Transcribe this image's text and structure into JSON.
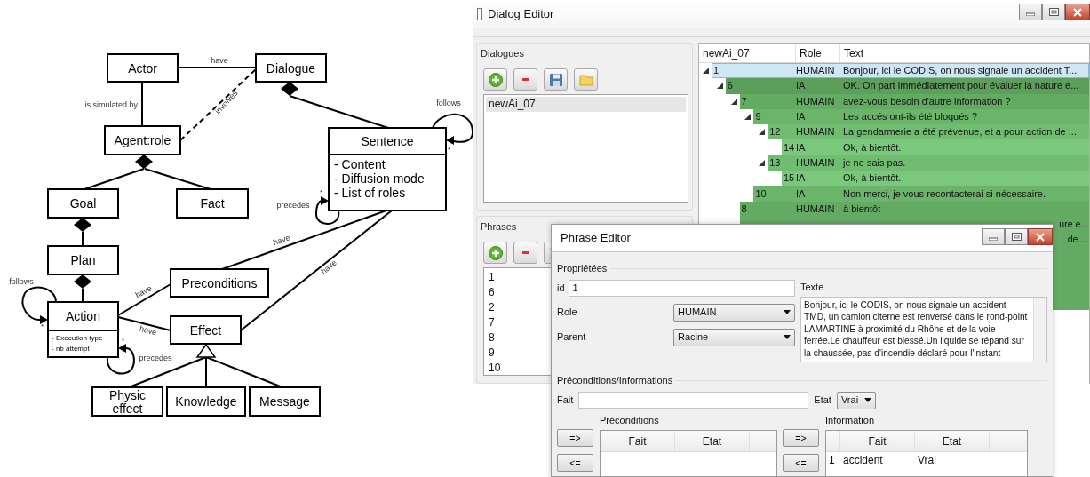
{
  "diagram": {
    "classes": [
      {
        "name": "Actor"
      },
      {
        "name": "Dialogue"
      },
      {
        "name": "Agent:role"
      },
      {
        "name": "Goal"
      },
      {
        "name": "Fact"
      },
      {
        "name": "Plan"
      },
      {
        "name": "Action",
        "attributes": [
          "-  Execution type",
          "- nb attempt"
        ]
      },
      {
        "name": "Preconditions"
      },
      {
        "name": "Effect"
      },
      {
        "name": "Physic effect"
      },
      {
        "name": "Knowledge"
      },
      {
        "name": "Message"
      },
      {
        "name": "Sentence",
        "attributes": [
          "- Content",
          "- Diffusion mode",
          "- List of roles"
        ]
      }
    ],
    "relations": [
      {
        "kind": "association",
        "label": "have"
      },
      {
        "kind": "association",
        "label": "is simulated by"
      },
      {
        "kind": "dependency",
        "label": "involves"
      },
      {
        "kind": "composition"
      },
      {
        "kind": "composition"
      },
      {
        "kind": "composition"
      },
      {
        "kind": "composition"
      },
      {
        "kind": "loop",
        "label": "follows",
        "multiplicity": "*"
      },
      {
        "kind": "loop",
        "label": "precedes",
        "multiplicity": "*"
      },
      {
        "kind": "association",
        "label": "have"
      },
      {
        "kind": "association",
        "label": "have"
      },
      {
        "kind": "association",
        "label": "have"
      },
      {
        "kind": "association",
        "label": "have"
      },
      {
        "kind": "loop",
        "label": "follows",
        "multiplicity": "*"
      },
      {
        "kind": "loop",
        "label": "precedes",
        "multiplicity": "*"
      },
      {
        "kind": "generalization"
      }
    ]
  },
  "dialog_editor": {
    "title": "Dialog Editor",
    "dialogues": {
      "label": "Dialogues",
      "items": [
        {
          "label": "newAi_07",
          "selected": true
        }
      ]
    },
    "phrases": {
      "label": "Phrases",
      "items": [
        "1",
        "6",
        "2",
        "7",
        "8",
        "9",
        "10"
      ]
    },
    "tree": {
      "columns": [
        "newAi_07",
        "Role",
        "Text"
      ],
      "rows": [
        {
          "id": "1",
          "role": "HUMAIN",
          "text": "Bonjour, ici le CODIS, on nous signale un accident T...",
          "selected": true,
          "expanded": true,
          "children": [
            {
              "id": "6",
              "role": "IA",
              "text": "OK. On part immédiatement pour évaluer la nature e...",
              "selected": false,
              "expanded": true,
              "children": [
                {
                  "id": "7",
                  "role": "HUMAIN",
                  "text": "avez-vous besoin d'autre information ?",
                  "selected": false,
                  "expanded": true,
                  "children": [
                    {
                      "id": "9",
                      "role": "IA",
                      "text": "Les accés ont-ils été bloqués ?",
                      "selected": false,
                      "expanded": true,
                      "children": [
                        {
                          "id": "12",
                          "role": "HUMAIN",
                          "text": "La gendarmerie a été prévenue, et a pour action de ...",
                          "selected": false,
                          "expanded": true,
                          "children": [
                            {
                              "id": "14",
                              "role": "IA",
                              "text": "Ok, à bientôt.",
                              "selected": false
                            }
                          ]
                        },
                        {
                          "id": "13",
                          "role": "HUMAIN",
                          "text": "je ne sais pas.",
                          "selected": false,
                          "expanded": true,
                          "children": [
                            {
                              "id": "15",
                              "role": "IA",
                              "text": "Ok, à bientôt.",
                              "selected": false
                            }
                          ]
                        }
                      ]
                    },
                    {
                      "id": "10",
                      "role": "IA",
                      "text": "Non merci, je vous recontacterai si nécessaire.",
                      "selected": false
                    }
                  ]
                },
                {
                  "id": "8",
                  "role": "HUMAIN",
                  "text": "à bientôt",
                  "selected": false
                },
                {
                  "text": "ure e...",
                  "selected": false
                },
                {
                  "text": "de ...",
                  "selected": false
                }
              ]
            }
          ]
        }
      ]
    }
  },
  "phrase_editor": {
    "title": "Phrase Editor",
    "properties": {
      "label": "Propriétées",
      "id_label": "id",
      "id_value": "1",
      "role_label": "Role",
      "role_value": "HUMAIN",
      "parent_label": "Parent",
      "parent_value": "Racine",
      "text_label": "Texte",
      "text_value": "Bonjour, ici le CODIS, on nous signale un accident TMD, un camion citerne est renversé dans le rond-point LAMARTINE à proximité du Rhône et de la voie ferrée.Le chauffeur est blessé.Un liquide se répand sur la chaussée, pas d'incendie déclaré pour l'instant"
    },
    "facts": {
      "label": "Préconditions/Informations",
      "fait_label": "Fait",
      "etat_label": "Etat",
      "etat_value": "Vrai",
      "preconditions": {
        "label": "Préconditions",
        "add_button": "=>",
        "remove_button": "<=",
        "columns": [
          "Fait",
          "Etat"
        ]
      },
      "information": {
        "label": "Information",
        "add_button": "=>",
        "remove_button": "<=",
        "columns": [
          "Fait",
          "Etat"
        ],
        "rows": [
          {
            "number": "1",
            "fait": "accident",
            "etat": "Vrai"
          }
        ]
      }
    }
  }
}
